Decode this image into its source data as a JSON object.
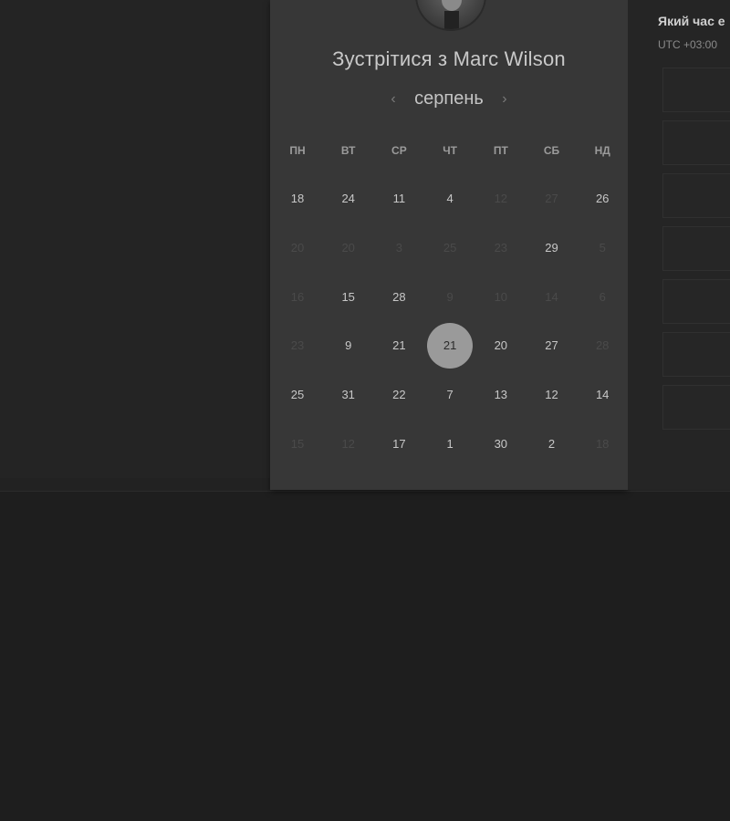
{
  "booking": {
    "title": "Зустрітися з Marc Wilson",
    "month": "серпень",
    "prev_icon": "‹",
    "next_icon": "›",
    "weekdays": [
      "ПН",
      "ВТ",
      "СР",
      "ЧТ",
      "ПТ",
      "СБ",
      "НД"
    ],
    "weeks": [
      [
        {
          "d": "18",
          "on": true
        },
        {
          "d": "24",
          "on": true
        },
        {
          "d": "11",
          "on": true
        },
        {
          "d": "4",
          "on": true
        },
        {
          "d": "12",
          "on": false
        },
        {
          "d": "27",
          "on": false
        },
        {
          "d": "26",
          "on": true
        }
      ],
      [
        {
          "d": "20",
          "on": false
        },
        {
          "d": "20",
          "on": false
        },
        {
          "d": "3",
          "on": false
        },
        {
          "d": "25",
          "on": false
        },
        {
          "d": "23",
          "on": false
        },
        {
          "d": "29",
          "on": true
        },
        {
          "d": "5",
          "on": false
        }
      ],
      [
        {
          "d": "16",
          "on": false
        },
        {
          "d": "15",
          "on": true
        },
        {
          "d": "28",
          "on": true
        },
        {
          "d": "9",
          "on": false
        },
        {
          "d": "10",
          "on": false
        },
        {
          "d": "14",
          "on": false
        },
        {
          "d": "6",
          "on": false
        }
      ],
      [
        {
          "d": "23",
          "on": false
        },
        {
          "d": "9",
          "on": true
        },
        {
          "d": "21",
          "on": true
        },
        {
          "d": "21",
          "on": true,
          "sel": true
        },
        {
          "d": "20",
          "on": true
        },
        {
          "d": "27",
          "on": true
        },
        {
          "d": "28",
          "on": false
        }
      ],
      [
        {
          "d": "25",
          "on": true
        },
        {
          "d": "31",
          "on": true
        },
        {
          "d": "22",
          "on": true
        },
        {
          "d": "7",
          "on": true
        },
        {
          "d": "13",
          "on": true
        },
        {
          "d": "12",
          "on": true
        },
        {
          "d": "14",
          "on": true
        }
      ],
      [
        {
          "d": "15",
          "on": false
        },
        {
          "d": "12",
          "on": false
        },
        {
          "d": "17",
          "on": true
        },
        {
          "d": "1",
          "on": true
        },
        {
          "d": "30",
          "on": true
        },
        {
          "d": "2",
          "on": true
        },
        {
          "d": "18",
          "on": false
        }
      ]
    ]
  },
  "timepanel": {
    "title": "Який час е",
    "timezone": "UTC +03:00"
  },
  "colors": {
    "selected": "#9a9a9a",
    "card": "#373737",
    "background": "#1e1e1e"
  }
}
